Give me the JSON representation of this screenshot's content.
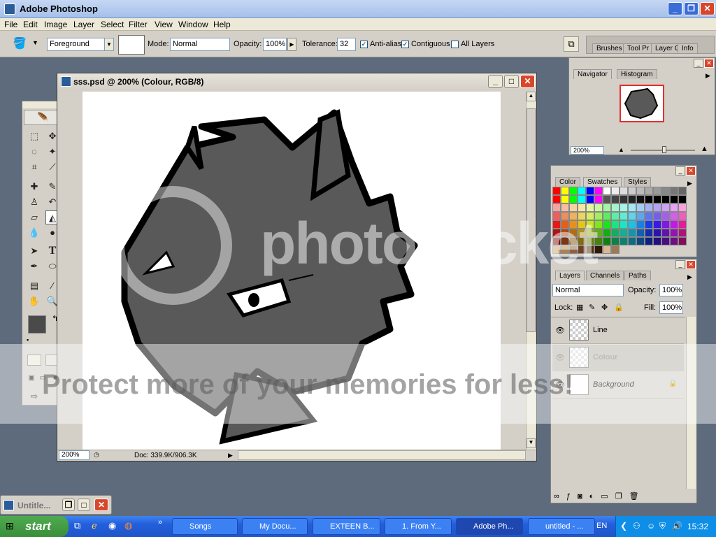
{
  "app": {
    "title": "Adobe Photoshop"
  },
  "menu": [
    "File",
    "Edit",
    "Image",
    "Layer",
    "Select",
    "Filter",
    "View",
    "Window",
    "Help"
  ],
  "options": {
    "fill_source": "Foreground",
    "mode_label": "Mode:",
    "mode_value": "Normal",
    "opacity_label": "Opacity:",
    "opacity_value": "100%",
    "tolerance_label": "Tolerance:",
    "tolerance_value": "32",
    "antialias_label": "Anti-alias",
    "contiguous_label": "Contiguous",
    "all_layers_label": "All Layers",
    "antialias_checked": true,
    "contiguous_checked": true,
    "all_layers_checked": false
  },
  "palette_well": [
    "Brushes",
    "Tool Pr",
    "Layer C",
    "Info"
  ],
  "document": {
    "title": "sss.psd @ 200% (Colour, RGB/8)",
    "zoom": "200%",
    "doc_size": "Doc: 339.9K/906.3K"
  },
  "navigator": {
    "tabs": [
      "Navigator",
      "Histogram"
    ],
    "zoom": "200%"
  },
  "swatches_panel": {
    "tabs": [
      "Color",
      "Swatches",
      "Styles"
    ]
  },
  "layers_panel": {
    "tabs": [
      "Layers",
      "Channels",
      "Paths"
    ],
    "blend_mode": "Normal",
    "opacity_label": "Opacity:",
    "opacity_value": "100%",
    "lock_label": "Lock:",
    "fill_label": "Fill:",
    "fill_value": "100%",
    "layers": [
      {
        "name": "Line"
      },
      {
        "name": "Colour"
      },
      {
        "name": "Background"
      }
    ]
  },
  "minimized_window": {
    "title": "Untitle..."
  },
  "taskbar": {
    "start_label": "start",
    "buttons": [
      "Songs",
      "My Docu...",
      "EXTEEN B...",
      "1. From Y...",
      "Adobe Ph...",
      "untitled - ..."
    ],
    "language": "EN",
    "clock": "15:32"
  },
  "watermark": {
    "brand": "photobucket",
    "tagline": "Protect more of your memories for less!"
  },
  "colors": {
    "xp_blue": "#245edb",
    "start_green": "#3a8e3a",
    "workspace": "#5d6b7c",
    "panel_bg": "#d4d0c8"
  }
}
